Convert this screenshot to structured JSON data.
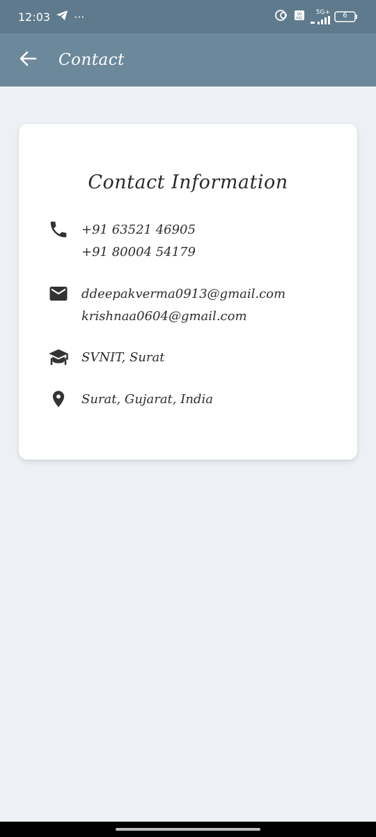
{
  "status_bar": {
    "time": "12:03",
    "more": "···",
    "network": "5G+",
    "battery": "6"
  },
  "app_bar": {
    "title": "Contact"
  },
  "card": {
    "title": "Contact Information",
    "phone": [
      "+91 63521 46905",
      "+91 80004 54179"
    ],
    "email": [
      "ddeepakverma0913@gmail.com",
      "krishnaa0604@gmail.com"
    ],
    "education": "SVNIT, Surat",
    "location": "Surat, Gujarat, India"
  },
  "colors": {
    "status_bar": "#5f7a8c",
    "app_bar": "#6c899b",
    "background": "#edf0f5",
    "card": "#ffffff",
    "icon": "#333333"
  },
  "icons": {
    "back": "arrow-left-icon",
    "phone": "phone-icon",
    "email": "mail-icon",
    "education": "graduation-cap-icon",
    "location": "location-pin-icon"
  }
}
